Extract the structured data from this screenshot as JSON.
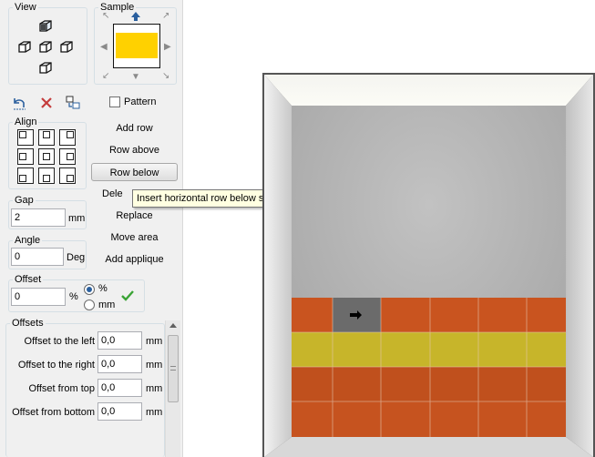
{
  "panel": {
    "view_title": "View",
    "sample_title": "Sample",
    "pattern_label": "Pattern",
    "align_title": "Align",
    "gap_title": "Gap",
    "gap_value": "2",
    "gap_unit": "mm",
    "angle_title": "Angle",
    "angle_value": "0",
    "angle_unit": "Deg",
    "offset_title": "Offset",
    "offset_value": "0",
    "offset_unit": "%",
    "radio_percent": "%",
    "radio_mm": "mm",
    "offsets_title": "Offsets",
    "offsets": [
      {
        "label": "Offset to the left",
        "value": "0,0",
        "unit": "mm"
      },
      {
        "label": "Offset to the right",
        "value": "0,0",
        "unit": "mm"
      },
      {
        "label": "Offset from top",
        "value": "0,0",
        "unit": "mm"
      },
      {
        "label": "Offset from bottom",
        "value": "0,0",
        "unit": "mm"
      }
    ]
  },
  "actions": {
    "add_row": "Add row",
    "row_above": "Row above",
    "row_below": "Row below",
    "delete": "Dele",
    "replace": "Replace",
    "move_area": "Move area",
    "add_applique": "Add applique"
  },
  "tooltip": "Insert horizontal row below selected tile",
  "colors": {
    "sample_tile": "#ffd100",
    "orange_tile": "#c9541f",
    "yellow_tile": "#c7b52a",
    "selected_tile": "#6b6b6b",
    "accent_blue": "#2a5f9e",
    "check_green": "#3aa335",
    "delete_red": "#c43c3c"
  },
  "icons": {
    "undo": "undo-icon",
    "delete": "delete-icon",
    "copy": "copy-icon",
    "apply": "checkmark-icon",
    "selected_tile_marker": "right-arrow-icon"
  }
}
